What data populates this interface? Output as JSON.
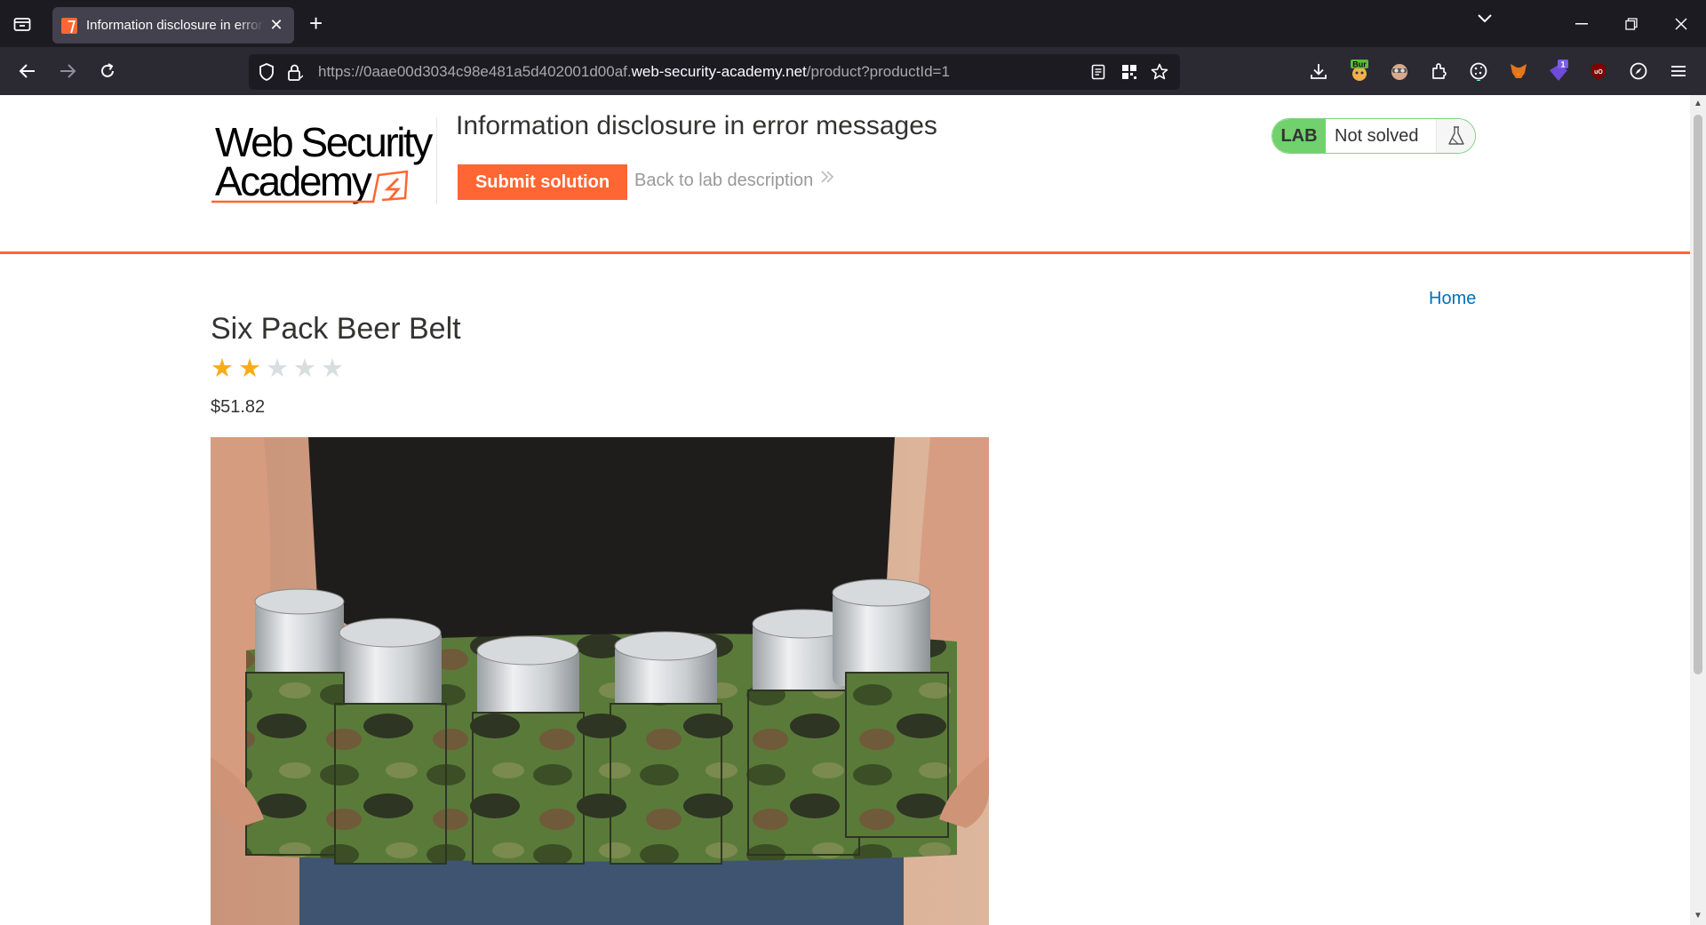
{
  "browser": {
    "tab_title": "Information disclosure in error messages",
    "url_prefix": "https://0aae00d3034c98e481a5d402001d00af.",
    "url_host": "web-security-academy.net",
    "url_path": "/product?productId=1",
    "extension_badges": {
      "burp": "Bur",
      "notif": "1",
      "ublock": "uO"
    }
  },
  "header": {
    "logo_line1": "Web Security",
    "logo_line2": "Academy",
    "lab_title": "Information disclosure in error messages",
    "submit_label": "Submit solution",
    "back_label": "Back to lab description",
    "status_label": "LAB",
    "status_value": "Not solved"
  },
  "nav": {
    "home_label": "Home"
  },
  "product": {
    "name": "Six Pack Beer Belt",
    "rating": 2,
    "rating_max": 5,
    "price": "$51.82"
  },
  "colors": {
    "accent": "#ff6633",
    "lab_green": "#70d16d",
    "link": "#0071bc",
    "star_on": "#f7ad19",
    "star_off": "#d8dde0"
  }
}
